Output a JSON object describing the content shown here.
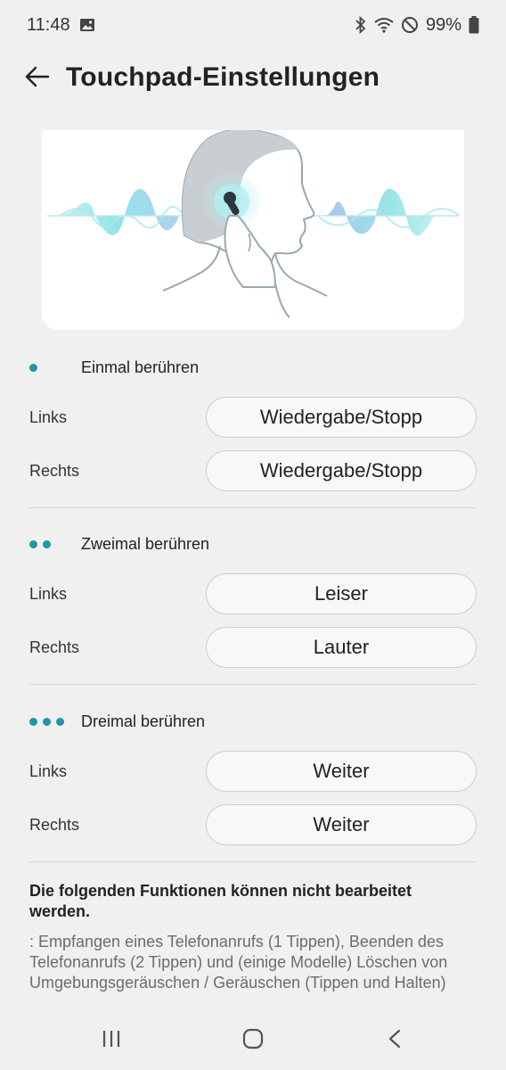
{
  "status_bar": {
    "time": "11:48",
    "battery": "99%",
    "icons": [
      "gallery-icon",
      "bluetooth-icon",
      "wifi-icon",
      "do-not-disturb-icon",
      "battery-icon"
    ]
  },
  "header": {
    "title": "Touchpad-Einstellungen",
    "back_icon": "arrow-left-icon"
  },
  "colors": {
    "accent": "#1f96a8",
    "background": "#f0f0f0",
    "button_bg": "#f8f8f8"
  },
  "sections": [
    {
      "title": "Einmal berühren",
      "dots": 1,
      "rows": [
        {
          "label": "Links",
          "value": "Wiedergabe/Stopp"
        },
        {
          "label": "Rechts",
          "value": "Wiedergabe/Stopp"
        }
      ]
    },
    {
      "title": "Zweimal berühren",
      "dots": 2,
      "rows": [
        {
          "label": "Links",
          "value": "Leiser"
        },
        {
          "label": "Rechts",
          "value": "Lauter"
        }
      ]
    },
    {
      "title": "Dreimal berühren",
      "dots": 3,
      "rows": [
        {
          "label": "Links",
          "value": "Weiter"
        },
        {
          "label": "Rechts",
          "value": "Weiter"
        }
      ]
    }
  ],
  "note": {
    "title": "Die folgenden Funktionen können nicht bearbeitet werden.",
    "text": ": Empfangen eines Telefonanrufs (1 Tippen), Beenden des Telefonanrufs (2 Tippen) und (einige Modelle) Löschen von Umgebungsgeräuschen / Geräuschen (Tippen und Halten)"
  },
  "navbar": {
    "icons": [
      "recent-apps-icon",
      "home-icon",
      "back-icon"
    ]
  }
}
